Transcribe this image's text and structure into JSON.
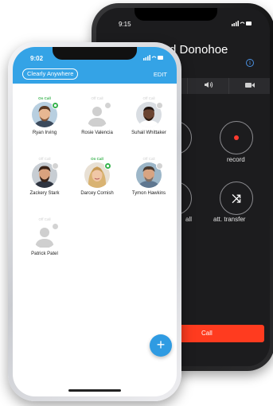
{
  "back_phone": {
    "status_time": "9:15",
    "contact_name": "d Donohoe",
    "info_icon": "info-icon",
    "tab_icons": [
      "speaker-icon",
      "video-icon"
    ],
    "buttons": {
      "record": "record",
      "hold_partial": "all",
      "att_transfer": "att. transfer"
    },
    "end_call_label": "Call",
    "colors": {
      "end_call": "#ff3b1f",
      "record_dot": "#ff3b30"
    }
  },
  "front_phone": {
    "status_time": "9:02",
    "app_title": "Clearly Anywhere",
    "edit_label": "EDIT",
    "fab_label": "+",
    "contacts": [
      {
        "name": "Ryan Irving",
        "status": "On Call",
        "on_call": true
      },
      {
        "name": "Rosie Valencia",
        "status": "Off Call",
        "on_call": false
      },
      {
        "name": "Suhail Whittaker",
        "status": "Off Call",
        "on_call": false
      },
      {
        "name": "Zackery Stark",
        "status": "Off Call",
        "on_call": false
      },
      {
        "name": "Darcey Cornish",
        "status": "On Call",
        "on_call": true
      },
      {
        "name": "Tymon Hawkins",
        "status": "Off Call",
        "on_call": false
      },
      {
        "name": "Patrick Patel",
        "status": "Off Call",
        "on_call": false
      }
    ],
    "colors": {
      "header": "#34a3e6",
      "on_call": "#37b24d",
      "fab": "#2f9be2"
    }
  }
}
